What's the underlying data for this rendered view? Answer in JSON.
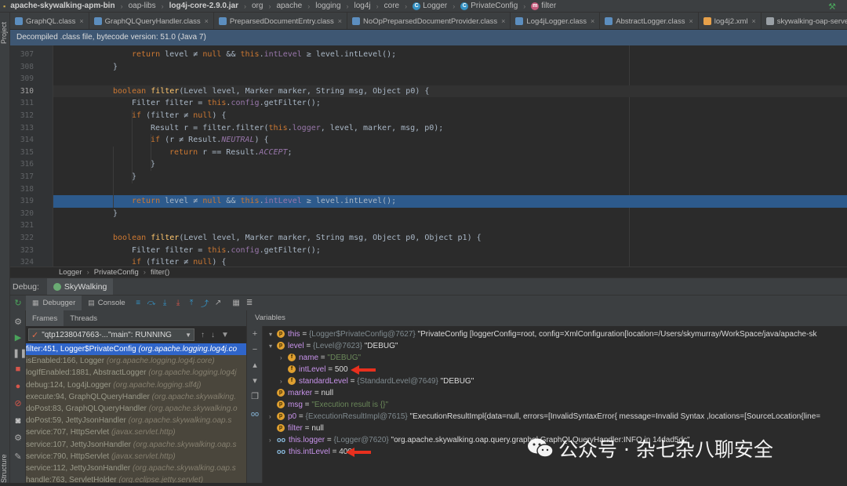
{
  "navbar": {
    "crumbs": [
      {
        "label": "apache-skywalking-apm-bin",
        "bold": true
      },
      {
        "label": "oap-libs"
      },
      {
        "label": "log4j-core-2.9.0.jar",
        "bold": true
      },
      {
        "label": "org"
      },
      {
        "label": "apache"
      },
      {
        "label": "logging"
      },
      {
        "label": "log4j"
      },
      {
        "label": "core"
      },
      {
        "label": "Logger",
        "icon": "class"
      },
      {
        "label": "PrivateConfig",
        "icon": "class"
      },
      {
        "label": "filter",
        "icon": "method"
      }
    ]
  },
  "left_strip": {
    "project_label": "Project",
    "structure_label": "Structure"
  },
  "tabs": [
    {
      "label": "GraphQL.class",
      "icon": "class"
    },
    {
      "label": "GraphQLQueryHandler.class",
      "icon": "class"
    },
    {
      "label": "PreparsedDocumentEntry.class",
      "icon": "class"
    },
    {
      "label": "NoOpPreparsedDocumentProvider.class",
      "icon": "class"
    },
    {
      "label": "Log4jLogger.class",
      "icon": "class"
    },
    {
      "label": "AbstractLogger.class",
      "icon": "class"
    },
    {
      "label": "log4j2.xml",
      "icon": "xml"
    },
    {
      "label": "skywalking-oap-server.log",
      "icon": "log"
    }
  ],
  "decompiled_banner": "Decompiled .class file, bytecode version: 51.0 (Java 7)",
  "code_lines": [
    {
      "num": "307",
      "indent": 2,
      "tokens": [
        [
          "kw",
          "return"
        ],
        [
          "t",
          " level ≠ "
        ],
        [
          "kw",
          "null"
        ],
        [
          "t",
          " && "
        ],
        [
          "kw",
          "this"
        ],
        [
          "t",
          "."
        ],
        [
          "fld",
          "intLevel"
        ],
        [
          "t",
          " ≥ level.intLevel();"
        ]
      ]
    },
    {
      "num": "308",
      "indent": 1,
      "tokens": [
        [
          "t",
          "}"
        ]
      ]
    },
    {
      "num": "309",
      "indent": 0,
      "tokens": []
    },
    {
      "num": "310",
      "indent": 1,
      "cur": true,
      "tokens": [
        [
          "kw",
          "boolean"
        ],
        [
          "t",
          " "
        ],
        [
          "fn",
          "filter"
        ],
        [
          "t",
          "(Level level, Marker marker, String msg, Object p0) {"
        ]
      ]
    },
    {
      "num": "311",
      "indent": 2,
      "tokens": [
        [
          "t",
          "Filter filter = "
        ],
        [
          "kw",
          "this"
        ],
        [
          "t",
          "."
        ],
        [
          "fld",
          "config"
        ],
        [
          "t",
          ".getFilter();"
        ]
      ]
    },
    {
      "num": "312",
      "indent": 2,
      "tokens": [
        [
          "kw",
          "if"
        ],
        [
          "t",
          " (filter ≠ "
        ],
        [
          "kw",
          "null"
        ],
        [
          "t",
          ") {"
        ]
      ]
    },
    {
      "num": "313",
      "indent": 3,
      "tokens": [
        [
          "t",
          "Result r = filter.filter("
        ],
        [
          "kw",
          "this"
        ],
        [
          "t",
          "."
        ],
        [
          "fld",
          "logger"
        ],
        [
          "t",
          ", level, marker, msg, p0);"
        ]
      ]
    },
    {
      "num": "314",
      "indent": 3,
      "tokens": [
        [
          "kw",
          "if"
        ],
        [
          "t",
          " (r ≠ Result."
        ],
        [
          "ital",
          "NEUTRAL"
        ],
        [
          "t",
          ") {"
        ]
      ]
    },
    {
      "num": "315",
      "indent": 4,
      "tokens": [
        [
          "kw",
          "return"
        ],
        [
          "t",
          " r == Result."
        ],
        [
          "ital",
          "ACCEPT"
        ],
        [
          "t",
          ";"
        ]
      ]
    },
    {
      "num": "316",
      "indent": 3,
      "tokens": [
        [
          "t",
          "}"
        ]
      ]
    },
    {
      "num": "317",
      "indent": 2,
      "tokens": [
        [
          "t",
          "}"
        ]
      ]
    },
    {
      "num": "318",
      "indent": 0,
      "tokens": []
    },
    {
      "num": "319",
      "indent": 2,
      "hl": true,
      "tokens": [
        [
          "kw",
          "return"
        ],
        [
          "t",
          " level ≠ "
        ],
        [
          "kw",
          "null"
        ],
        [
          "t",
          " && "
        ],
        [
          "kw",
          "this"
        ],
        [
          "t",
          "."
        ],
        [
          "fld",
          "intLevel"
        ],
        [
          "t",
          " ≥ level.intLevel();"
        ]
      ]
    },
    {
      "num": "320",
      "indent": 1,
      "tokens": [
        [
          "t",
          "}"
        ]
      ]
    },
    {
      "num": "321",
      "indent": 0,
      "tokens": []
    },
    {
      "num": "322",
      "indent": 1,
      "tokens": [
        [
          "kw",
          "boolean"
        ],
        [
          "t",
          " "
        ],
        [
          "fn",
          "filter"
        ],
        [
          "t",
          "(Level level, Marker marker, String msg, Object p0, Object p1) {"
        ]
      ]
    },
    {
      "num": "323",
      "indent": 2,
      "tokens": [
        [
          "t",
          "Filter filter = "
        ],
        [
          "kw",
          "this"
        ],
        [
          "t",
          "."
        ],
        [
          "fld",
          "config"
        ],
        [
          "t",
          ".getFilter();"
        ]
      ]
    },
    {
      "num": "324",
      "indent": 2,
      "tokens": [
        [
          "kw",
          "if"
        ],
        [
          "t",
          " (filter ≠ "
        ],
        [
          "kw",
          "null"
        ],
        [
          "t",
          ") {"
        ]
      ]
    }
  ],
  "editor_breadcrumb": [
    "Logger",
    "PrivateConfig",
    "filter()"
  ],
  "debug": {
    "label": "Debug:",
    "session": "SkyWalking",
    "tabs": [
      "Debugger",
      "Console"
    ],
    "frames_tabs": [
      "Frames",
      "Threads"
    ],
    "thread": "\"qtp1238047663-...\"main\": RUNNING",
    "frames": [
      {
        "text": "filter:451, Logger$PrivateConfig ",
        "pkg": "(org.apache.logging.log4j.co",
        "kind": "sel"
      },
      {
        "text": "isEnabled:166, Logger ",
        "pkg": "(org.apache.logging.log4j.core)",
        "kind": "lib"
      },
      {
        "text": "logIfEnabled:1881, AbstractLogger ",
        "pkg": "(org.apache.logging.log4j",
        "kind": "lib"
      },
      {
        "text": "debug:124, Log4jLogger ",
        "pkg": "(org.apache.logging.slf4j)",
        "kind": "lib"
      },
      {
        "text": "execute:94, GraphQLQueryHandler ",
        "pkg": "(org.apache.skywalking.",
        "kind": "lib"
      },
      {
        "text": "doPost:83, GraphQLQueryHandler ",
        "pkg": "(org.apache.skywalking.o",
        "kind": "lib"
      },
      {
        "text": "doPost:59, JettyJsonHandler ",
        "pkg": "(org.apache.skywalking.oap.s",
        "kind": "lib"
      },
      {
        "text": "service:707, HttpServlet ",
        "pkg": "(javax.servlet.http)",
        "kind": "lib"
      },
      {
        "text": "service:107, JettyJsonHandler ",
        "pkg": "(org.apache.skywalking.oap.s",
        "kind": "lib"
      },
      {
        "text": "service:790, HttpServlet ",
        "pkg": "(javax.servlet.http)",
        "kind": "lib"
      },
      {
        "text": "service:112, JettyJsonHandler ",
        "pkg": "(org.apache.skywalking.oap.s",
        "kind": "lib"
      },
      {
        "text": "handle:763, ServletHolder ",
        "pkg": "(org.eclipse.jetty.servlet)",
        "kind": "lib"
      }
    ],
    "variables_label": "Variables",
    "variables": [
      {
        "depth": 0,
        "arrow": "▾",
        "icon": "p",
        "name": "this",
        "rest_type": "{Logger$PrivateConfig@7627}",
        "rest_val": " \"PrivateConfig [loggerConfig=root, config=XmlConfiguration[location=/Users/skymurray/WorkSpace/java/apache-sk"
      },
      {
        "depth": 0,
        "arrow": "▾",
        "icon": "p",
        "name": "level",
        "rest_type": "{Level@7623}",
        "rest_val": " \"DEBUG\""
      },
      {
        "depth": 1,
        "arrow": "›",
        "icon": "f",
        "name": "name",
        "rest_str": "\"DEBUG\""
      },
      {
        "depth": 1,
        "arrow": "",
        "icon": "f",
        "name": "intLevel",
        "rest_num": "500",
        "mark": true
      },
      {
        "depth": 1,
        "arrow": "›",
        "icon": "f",
        "name": "standardLevel",
        "rest_type": "{StandardLevel@7649}",
        "rest_val": " \"DEBUG\""
      },
      {
        "depth": 0,
        "arrow": "",
        "icon": "p",
        "name": "marker",
        "rest_num": "null"
      },
      {
        "depth": 0,
        "arrow": "",
        "icon": "p",
        "name": "msg",
        "rest_str": "\"Execution result is {}\""
      },
      {
        "depth": 0,
        "arrow": "›",
        "icon": "p",
        "name": "p0",
        "rest_type": "{ExecutionResultImpl@7615}",
        "rest_val": " \"ExecutionResultImpl{data=null, errors=[InvalidSyntaxError{ message=Invalid Syntax ,locations=[SourceLocation{line="
      },
      {
        "depth": 0,
        "arrow": "",
        "icon": "p",
        "name": "filter",
        "rest_num": "null"
      },
      {
        "depth": 0,
        "arrow": "›",
        "icon": "oo",
        "name": "this.logger",
        "rest_type": "{Logger@7620}",
        "rest_val": " \"org.apache.skywalking.oap.query.graphql.GraphQLQueryHandler:INFO in 14dad5dc\""
      },
      {
        "depth": 0,
        "arrow": "",
        "icon": "oo",
        "name": "this.intLevel",
        "rest_num": "400",
        "mark": true
      }
    ]
  },
  "watermark": "公众号 · 杂七杂八聊安全",
  "colors": {
    "accent": "#2f65ca",
    "highlight": "#2d5a8c",
    "banner": "#3e5773",
    "annotation": "#e8301e"
  }
}
